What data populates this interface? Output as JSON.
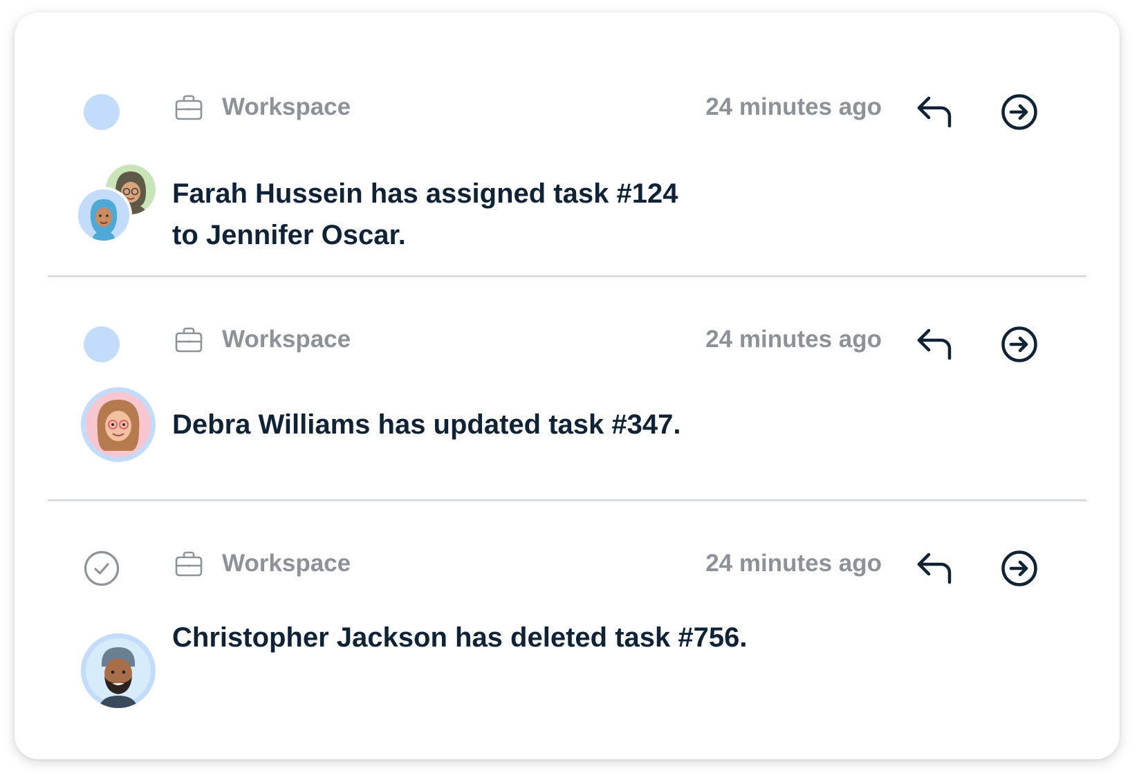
{
  "notifications": [
    {
      "status": "unread",
      "source_label": "Workspace",
      "time": "24 minutes ago",
      "message_line1": "Farah Hussein has assigned task #124",
      "message_line2": "to Jennifer Oscar."
    },
    {
      "status": "unread",
      "source_label": "Workspace",
      "time": "24 minutes ago",
      "message": "Debra Williams has updated task #347."
    },
    {
      "status": "read",
      "source_label": "Workspace",
      "time": "24 minutes ago",
      "message": "Christopher Jackson has deleted task #756."
    }
  ],
  "colors": {
    "unread_dot": "#c4dcfb",
    "muted_text": "#8d9299",
    "message_text": "#0f2236",
    "icon_dark": "#0f2236",
    "divider": "#d7dbe1"
  },
  "icons": {
    "status_unread": "dot-icon",
    "status_read": "check-circle-icon",
    "source": "briefcase-icon",
    "reply": "reply-arrow-icon",
    "open": "arrow-right-circle-icon"
  }
}
